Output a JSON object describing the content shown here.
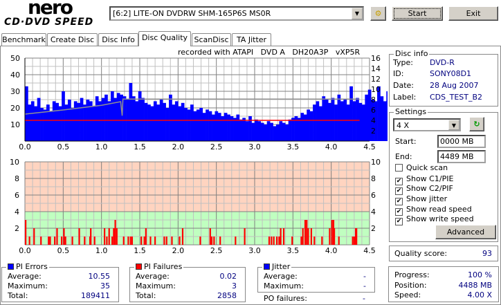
{
  "app": {
    "logo_top": "nero",
    "logo_bottom": "CD·DVD SPEED"
  },
  "toolbar": {
    "drive": "[6:2]  LITE-ON DVDRW SHM-165P6S MS0R",
    "start_label": "Start",
    "exit_label": "Exit"
  },
  "tabs": [
    {
      "label": "Benchmark"
    },
    {
      "label": "Create Disc"
    },
    {
      "label": "Disc Info"
    },
    {
      "label": "Disc Quality",
      "active": true
    },
    {
      "label": "ScanDisc"
    },
    {
      "label": "TA Jitter"
    }
  ],
  "recorded_with": "recorded with ATAPI   DVD A   DH20A3P   vXP5R",
  "disc_info": {
    "title": "Disc info",
    "type_label": "Type:",
    "type": "DVD-R",
    "id_label": "ID:",
    "id": "SONY08D1",
    "date_label": "Date:",
    "date": "28 Aug 2007",
    "label_label": "Label:",
    "label": "CDS_TEST_B2"
  },
  "settings": {
    "title": "Settings",
    "speed": "4 X",
    "start_label": "Start:",
    "start": "0000 MB",
    "end_label": "End:",
    "end": "4489 MB",
    "checks": [
      {
        "label": "Quick scan",
        "checked": false
      },
      {
        "label": "Show C1/PIE",
        "checked": true
      },
      {
        "label": "Show C2/PIF",
        "checked": true
      },
      {
        "label": "Show jitter",
        "checked": true
      },
      {
        "label": "Show read speed",
        "checked": true
      },
      {
        "label": "Show write speed",
        "checked": true
      }
    ],
    "advanced_label": "Advanced"
  },
  "quality": {
    "label": "Quality score:",
    "value": "93"
  },
  "progress": {
    "progress_label": "Progress:",
    "progress": "100 %",
    "position_label": "Position:",
    "position": "4488 MB",
    "speed_label": "Speed:",
    "speed": "4.00 X"
  },
  "pi_errors": {
    "title": "PI Errors",
    "avg_label": "Average:",
    "avg": "10.55",
    "max_label": "Maximum:",
    "max": "35",
    "total_label": "Total:",
    "total": "189411",
    "color": "#0000ff"
  },
  "pi_failures": {
    "title": "PI Failures",
    "avg_label": "Average:",
    "avg": "0.02",
    "max_label": "Maximum:",
    "max": "3",
    "total_label": "Total:",
    "total": "2858",
    "color": "#ff0000"
  },
  "jitter": {
    "title": "Jitter",
    "avg_label": "Average:",
    "avg": "-",
    "max_label": "Maximum:",
    "max": "-",
    "po_label": "PO failures:",
    "po": "-",
    "color": "#0000ff"
  },
  "chart_data": [
    {
      "type": "bar",
      "title": "PI Errors",
      "xlim": [
        0,
        4.5
      ],
      "ylim": [
        0,
        50
      ],
      "y2lim": [
        0,
        16
      ],
      "xticks": [
        "0.0",
        "0.5",
        "1.0",
        "1.5",
        "2.0",
        "2.5",
        "3.0",
        "3.5",
        "4.0",
        "4.5"
      ],
      "yticks": [
        "10",
        "20",
        "30",
        "40",
        "50"
      ],
      "y2ticks": [
        "2",
        "4",
        "6",
        "8",
        "10",
        "12",
        "14",
        "16"
      ],
      "x_step": 0.04,
      "pie": [
        33,
        22,
        24,
        21,
        26,
        20,
        19,
        22,
        18,
        24,
        23,
        21,
        30,
        22,
        25,
        20,
        24,
        23,
        26,
        22,
        25,
        24,
        21,
        27,
        24,
        26,
        28,
        24,
        30,
        26,
        29,
        28,
        27,
        25,
        35,
        27,
        24,
        30,
        26,
        23,
        22,
        21,
        24,
        22,
        25,
        23,
        20,
        28,
        22,
        24,
        21,
        23,
        20,
        19,
        22,
        18,
        19,
        20,
        17,
        19,
        18,
        16,
        18,
        17,
        15,
        17,
        16,
        15,
        14,
        16,
        13,
        14,
        12,
        15,
        11,
        13,
        12,
        11,
        10,
        12,
        11,
        9,
        10,
        12,
        11,
        10,
        13,
        14,
        15,
        14,
        17,
        16,
        19,
        18,
        22,
        24,
        21,
        27,
        25,
        23,
        26,
        22,
        28,
        24,
        25,
        22,
        33,
        24,
        26,
        23,
        22,
        28,
        31,
        25,
        24,
        33,
        27,
        24,
        30,
        26
      ],
      "read_speed": [
        [
          0,
          5.2
        ],
        [
          0.5,
          6.0
        ],
        [
          1.0,
          6.9
        ],
        [
          1.25,
          7.6
        ],
        [
          1.27,
          4.9
        ],
        [
          1.28,
          8.1
        ],
        [
          4.37,
          8.1
        ]
      ],
      "write_speed": [
        [
          0,
          4.0
        ],
        [
          4.37,
          4.0
        ]
      ]
    },
    {
      "type": "bar",
      "title": "PI Failures",
      "xlim": [
        0,
        4.5
      ],
      "ylim": [
        0,
        10
      ],
      "threshold": 4,
      "xticks": [
        "0.0",
        "0.5",
        "1.0",
        "1.5",
        "2.0",
        "2.5",
        "3.0",
        "3.5",
        "4.0",
        "4.5"
      ],
      "yticks": [
        "2",
        "4",
        "6",
        "8",
        "10"
      ],
      "pif": [
        [
          0.0,
          3
        ],
        [
          0.05,
          1
        ],
        [
          0.11,
          2
        ],
        [
          0.2,
          1
        ],
        [
          0.3,
          1
        ],
        [
          0.32,
          1
        ],
        [
          0.38,
          1
        ],
        [
          0.41,
          2
        ],
        [
          0.47,
          1
        ],
        [
          0.5,
          2
        ],
        [
          0.52,
          1
        ],
        [
          0.61,
          1
        ],
        [
          0.7,
          2
        ],
        [
          0.77,
          1
        ],
        [
          0.84,
          1
        ],
        [
          0.85,
          2
        ],
        [
          0.9,
          1
        ],
        [
          1.03,
          2
        ],
        [
          1.06,
          1
        ],
        [
          1.09,
          2
        ],
        [
          1.13,
          1
        ],
        [
          1.15,
          2
        ],
        [
          1.17,
          3
        ],
        [
          1.19,
          2
        ],
        [
          1.28,
          1
        ],
        [
          1.34,
          1
        ],
        [
          1.37,
          1
        ],
        [
          1.39,
          1
        ],
        [
          1.51,
          1
        ],
        [
          1.55,
          1
        ],
        [
          1.57,
          2
        ],
        [
          1.63,
          1
        ],
        [
          1.69,
          1
        ],
        [
          1.81,
          1
        ],
        [
          1.84,
          1
        ],
        [
          1.91,
          1
        ],
        [
          2.01,
          1
        ],
        [
          2.05,
          2
        ],
        [
          2.28,
          1
        ],
        [
          2.41,
          2
        ],
        [
          2.43,
          1
        ],
        [
          2.46,
          1
        ],
        [
          2.54,
          1
        ],
        [
          2.74,
          1
        ],
        [
          2.86,
          2
        ],
        [
          3.18,
          1
        ],
        [
          3.21,
          1
        ],
        [
          3.24,
          1
        ],
        [
          3.28,
          1
        ],
        [
          3.31,
          1
        ],
        [
          3.33,
          2
        ],
        [
          3.37,
          2
        ],
        [
          3.48,
          1
        ],
        [
          3.6,
          1
        ],
        [
          3.62,
          2
        ],
        [
          3.65,
          3
        ],
        [
          3.67,
          3
        ],
        [
          3.69,
          2
        ],
        [
          3.73,
          2
        ],
        [
          3.77,
          1
        ],
        [
          3.87,
          1
        ],
        [
          3.97,
          2
        ],
        [
          4.0,
          3
        ],
        [
          4.02,
          3
        ],
        [
          4.03,
          2
        ],
        [
          4.09,
          1
        ],
        [
          4.27,
          1
        ],
        [
          4.29,
          1
        ],
        [
          4.31,
          2
        ],
        [
          4.32,
          2
        ]
      ]
    }
  ]
}
